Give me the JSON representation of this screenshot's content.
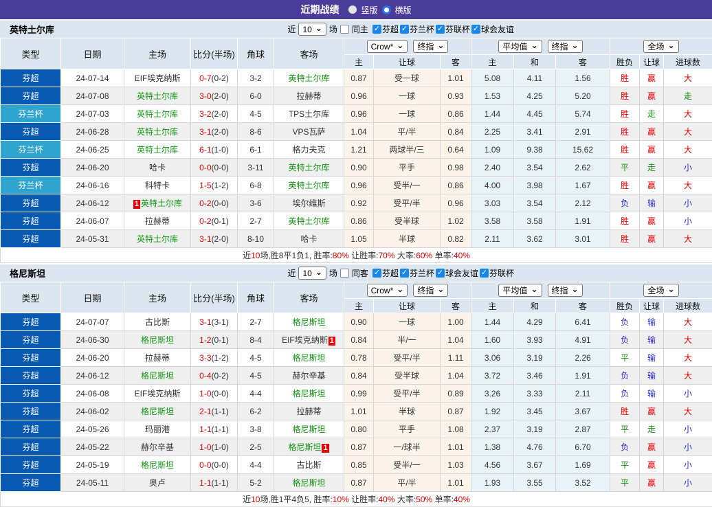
{
  "topbar": {
    "title": "近期战绩",
    "vertical_label": "竖版",
    "horizontal_label": "横版"
  },
  "icons": {
    "checkbox_check": "✓",
    "chevron_down": "⌄",
    "red_flag": "1"
  },
  "colors": {
    "accent_purple": "#4a3d99",
    "league_super": "#0759b2",
    "league_cup": "#2ea4cf",
    "team_green": "#139813",
    "score_red": "#e60000",
    "result_red": "#e60000",
    "result_green": "#108a10",
    "result_blue": "#2d2dd0",
    "header_bg": "#dce6f0",
    "odds_bg": "#fcf4ea",
    "avg_bg": "#e9f4f9",
    "alt_row_bg": "#efefef",
    "checkbox_blue": "#1a86e8"
  },
  "columns": {
    "main": [
      "类型",
      "日期",
      "主场",
      "比分(半场)",
      "角球",
      "客场"
    ],
    "sub": [
      "主",
      "让球",
      "客",
      "主",
      "和",
      "客",
      "胜负",
      "让球",
      "进球数"
    ]
  },
  "dropdowns": {
    "book": "Crow*",
    "final1": "终指",
    "avg": "平均值",
    "final2": "终指",
    "scope": "全场"
  },
  "sections": [
    {
      "team": "英特土尔库",
      "filters": {
        "near": "近",
        "count": "10",
        "games": "场",
        "same": "同主",
        "leagues": [
          "芬超",
          "芬兰杯",
          "芬联杯",
          "球会友谊"
        ]
      },
      "rows": [
        {
          "lg": "芬超",
          "cup": false,
          "date": "24-07-14",
          "home": {
            "n": "EIF埃克纳斯",
            "g": false
          },
          "score": "0-7",
          "half": "(0-2)",
          "corner": "3-2",
          "away": {
            "n": "英特土尔库",
            "g": true
          },
          "odds": [
            "0.87",
            "受一球",
            "1.01"
          ],
          "avg": [
            "5.08",
            "4.11",
            "1.56"
          ],
          "res": [
            [
              "胜",
              "r"
            ],
            [
              "赢",
              "r"
            ],
            [
              "大",
              "r"
            ]
          ]
        },
        {
          "lg": "芬超",
          "cup": false,
          "date": "24-07-08",
          "home": {
            "n": "英特土尔库",
            "g": true
          },
          "score": "3-0",
          "half": "(2-0)",
          "corner": "6-0",
          "away": {
            "n": "拉赫蒂",
            "g": false
          },
          "odds": [
            "0.96",
            "一球",
            "0.93"
          ],
          "avg": [
            "1.53",
            "4.25",
            "5.20"
          ],
          "res": [
            [
              "胜",
              "r"
            ],
            [
              "赢",
              "r"
            ],
            [
              "走",
              "g"
            ]
          ]
        },
        {
          "lg": "芬兰杯",
          "cup": true,
          "date": "24-07-03",
          "home": {
            "n": "英特土尔库",
            "g": true
          },
          "score": "3-2",
          "half": "(2-0)",
          "corner": "4-5",
          "away": {
            "n": "TPS土尔库",
            "g": false
          },
          "odds": [
            "0.96",
            "一球",
            "0.86"
          ],
          "avg": [
            "1.44",
            "4.45",
            "5.74"
          ],
          "res": [
            [
              "胜",
              "r"
            ],
            [
              "走",
              "g"
            ],
            [
              "大",
              "r"
            ]
          ]
        },
        {
          "lg": "芬超",
          "cup": false,
          "date": "24-06-28",
          "home": {
            "n": "英特土尔库",
            "g": true
          },
          "score": "3-1",
          "half": "(2-0)",
          "corner": "8-6",
          "away": {
            "n": "VPS瓦萨",
            "g": false
          },
          "odds": [
            "1.04",
            "平/半",
            "0.84"
          ],
          "avg": [
            "2.25",
            "3.41",
            "2.91"
          ],
          "res": [
            [
              "胜",
              "r"
            ],
            [
              "赢",
              "r"
            ],
            [
              "大",
              "r"
            ]
          ]
        },
        {
          "lg": "芬兰杯",
          "cup": true,
          "date": "24-06-25",
          "home": {
            "n": "英特土尔库",
            "g": true
          },
          "score": "6-1",
          "half": "(1-0)",
          "corner": "6-1",
          "away": {
            "n": "格力夫克",
            "g": false
          },
          "odds": [
            "1.21",
            "两球半/三",
            "0.64"
          ],
          "avg": [
            "1.09",
            "9.38",
            "15.62"
          ],
          "res": [
            [
              "胜",
              "r"
            ],
            [
              "赢",
              "r"
            ],
            [
              "大",
              "r"
            ]
          ]
        },
        {
          "lg": "芬超",
          "cup": false,
          "date": "24-06-20",
          "home": {
            "n": "哈卡",
            "g": false
          },
          "score": "0-0",
          "half": "(0-0)",
          "corner": "3-11",
          "away": {
            "n": "英特土尔库",
            "g": true
          },
          "odds": [
            "0.90",
            "平手",
            "0.98"
          ],
          "avg": [
            "2.40",
            "3.54",
            "2.62"
          ],
          "res": [
            [
              "平",
              "g"
            ],
            [
              "走",
              "g"
            ],
            [
              "小",
              "b"
            ]
          ]
        },
        {
          "lg": "芬兰杯",
          "cup": true,
          "date": "24-06-16",
          "home": {
            "n": "科特卡",
            "g": false
          },
          "score": "1-5",
          "half": "(1-2)",
          "corner": "6-8",
          "away": {
            "n": "英特土尔库",
            "g": true
          },
          "odds": [
            "0.96",
            "受半/一",
            "0.86"
          ],
          "avg": [
            "4.00",
            "3.98",
            "1.67"
          ],
          "res": [
            [
              "胜",
              "r"
            ],
            [
              "赢",
              "r"
            ],
            [
              "大",
              "r"
            ]
          ]
        },
        {
          "lg": "芬超",
          "cup": false,
          "date": "24-06-12",
          "home": {
            "n": "英特土尔库",
            "g": true,
            "b": "pre"
          },
          "score": "0-2",
          "half": "(0-0)",
          "corner": "3-6",
          "away": {
            "n": "埃尔维斯",
            "g": false
          },
          "odds": [
            "0.92",
            "受平/半",
            "0.96"
          ],
          "avg": [
            "3.03",
            "3.54",
            "2.12"
          ],
          "res": [
            [
              "负",
              "b"
            ],
            [
              "输",
              "b"
            ],
            [
              "小",
              "b"
            ]
          ]
        },
        {
          "lg": "芬超",
          "cup": false,
          "date": "24-06-07",
          "home": {
            "n": "拉赫蒂",
            "g": false
          },
          "score": "0-2",
          "half": "(0-1)",
          "corner": "2-7",
          "away": {
            "n": "英特土尔库",
            "g": true
          },
          "odds": [
            "0.86",
            "受半球",
            "1.02"
          ],
          "avg": [
            "3.58",
            "3.58",
            "1.91"
          ],
          "res": [
            [
              "胜",
              "r"
            ],
            [
              "赢",
              "r"
            ],
            [
              "小",
              "b"
            ]
          ]
        },
        {
          "lg": "芬超",
          "cup": false,
          "date": "24-05-31",
          "home": {
            "n": "英特土尔库",
            "g": true
          },
          "score": "3-1",
          "half": "(2-0)",
          "corner": "8-10",
          "away": {
            "n": "哈卡",
            "g": false
          },
          "odds": [
            "1.05",
            "半球",
            "0.82"
          ],
          "avg": [
            "2.11",
            "3.62",
            "3.01"
          ],
          "res": [
            [
              "胜",
              "r"
            ],
            [
              "赢",
              "r"
            ],
            [
              "大",
              "r"
            ]
          ]
        }
      ],
      "summary": [
        {
          "t": "近"
        },
        {
          "t": "10",
          "red": true
        },
        {
          "t": "场,胜8平1负1, 胜率:"
        },
        {
          "t": "80%",
          "red": true
        },
        {
          "t": " 让胜率:"
        },
        {
          "t": "70%",
          "red": true
        },
        {
          "t": " 大率:"
        },
        {
          "t": "60%",
          "red": true
        },
        {
          "t": " 单率:"
        },
        {
          "t": "40%",
          "red": true
        }
      ]
    },
    {
      "team": "格尼斯坦",
      "filters": {
        "near": "近",
        "count": "10",
        "games": "场",
        "same": "同客",
        "leagues": [
          "芬超",
          "芬兰杯",
          "球会友谊",
          "芬联杯"
        ]
      },
      "rows": [
        {
          "lg": "芬超",
          "cup": false,
          "date": "24-07-07",
          "home": {
            "n": "古比斯",
            "g": false
          },
          "score": "3-1",
          "half": "(3-1)",
          "corner": "2-7",
          "away": {
            "n": "格尼斯坦",
            "g": true
          },
          "odds": [
            "0.90",
            "一球",
            "1.00"
          ],
          "avg": [
            "1.44",
            "4.29",
            "6.41"
          ],
          "res": [
            [
              "负",
              "b"
            ],
            [
              "输",
              "b"
            ],
            [
              "大",
              "r"
            ]
          ]
        },
        {
          "lg": "芬超",
          "cup": false,
          "date": "24-06-30",
          "home": {
            "n": "格尼斯坦",
            "g": true
          },
          "score": "1-2",
          "half": "(0-1)",
          "corner": "8-4",
          "away": {
            "n": "EIF埃克纳斯",
            "g": false,
            "b": "post"
          },
          "odds": [
            "0.84",
            "半/一",
            "1.04"
          ],
          "avg": [
            "1.60",
            "3.93",
            "4.91"
          ],
          "res": [
            [
              "负",
              "b"
            ],
            [
              "输",
              "b"
            ],
            [
              "大",
              "r"
            ]
          ]
        },
        {
          "lg": "芬超",
          "cup": false,
          "date": "24-06-20",
          "home": {
            "n": "拉赫蒂",
            "g": false
          },
          "score": "3-3",
          "half": "(1-2)",
          "corner": "4-5",
          "away": {
            "n": "格尼斯坦",
            "g": true
          },
          "odds": [
            "0.78",
            "受平/半",
            "1.11"
          ],
          "avg": [
            "3.06",
            "3.19",
            "2.26"
          ],
          "res": [
            [
              "平",
              "g"
            ],
            [
              "输",
              "b"
            ],
            [
              "大",
              "r"
            ]
          ]
        },
        {
          "lg": "芬超",
          "cup": false,
          "date": "24-06-12",
          "home": {
            "n": "格尼斯坦",
            "g": true
          },
          "score": "0-4",
          "half": "(0-2)",
          "corner": "4-5",
          "away": {
            "n": "赫尔辛基",
            "g": false
          },
          "odds": [
            "0.84",
            "受半球",
            "1.04"
          ],
          "avg": [
            "3.72",
            "3.46",
            "1.91"
          ],
          "res": [
            [
              "负",
              "b"
            ],
            [
              "输",
              "b"
            ],
            [
              "大",
              "r"
            ]
          ]
        },
        {
          "lg": "芬超",
          "cup": false,
          "date": "24-06-08",
          "home": {
            "n": "EIF埃克纳斯",
            "g": false
          },
          "score": "1-0",
          "half": "(0-0)",
          "corner": "4-4",
          "away": {
            "n": "格尼斯坦",
            "g": true
          },
          "odds": [
            "0.99",
            "受平/半",
            "0.89"
          ],
          "avg": [
            "3.26",
            "3.33",
            "2.11"
          ],
          "res": [
            [
              "负",
              "b"
            ],
            [
              "输",
              "b"
            ],
            [
              "小",
              "b"
            ]
          ]
        },
        {
          "lg": "芬超",
          "cup": false,
          "date": "24-06-02",
          "home": {
            "n": "格尼斯坦",
            "g": true
          },
          "score": "2-1",
          "half": "(1-1)",
          "corner": "6-2",
          "away": {
            "n": "拉赫蒂",
            "g": false
          },
          "odds": [
            "1.01",
            "半球",
            "0.87"
          ],
          "avg": [
            "1.92",
            "3.45",
            "3.67"
          ],
          "res": [
            [
              "胜",
              "r"
            ],
            [
              "赢",
              "r"
            ],
            [
              "大",
              "r"
            ]
          ]
        },
        {
          "lg": "芬超",
          "cup": false,
          "date": "24-05-26",
          "home": {
            "n": "玛丽港",
            "g": false
          },
          "score": "1-1",
          "half": "(1-1)",
          "corner": "3-8",
          "away": {
            "n": "格尼斯坦",
            "g": true
          },
          "odds": [
            "0.80",
            "平手",
            "1.08"
          ],
          "avg": [
            "2.37",
            "3.19",
            "2.87"
          ],
          "res": [
            [
              "平",
              "g"
            ],
            [
              "走",
              "g"
            ],
            [
              "小",
              "b"
            ]
          ]
        },
        {
          "lg": "芬超",
          "cup": false,
          "date": "24-05-22",
          "home": {
            "n": "赫尔辛基",
            "g": false
          },
          "score": "1-0",
          "half": "(1-0)",
          "corner": "2-5",
          "away": {
            "n": "格尼斯坦",
            "g": true,
            "b": "post"
          },
          "odds": [
            "0.87",
            "一/球半",
            "1.01"
          ],
          "avg": [
            "1.38",
            "4.76",
            "6.70"
          ],
          "res": [
            [
              "负",
              "b"
            ],
            [
              "赢",
              "r"
            ],
            [
              "小",
              "b"
            ]
          ]
        },
        {
          "lg": "芬超",
          "cup": false,
          "date": "24-05-19",
          "home": {
            "n": "格尼斯坦",
            "g": true
          },
          "score": "0-0",
          "half": "(0-0)",
          "corner": "4-4",
          "away": {
            "n": "古比斯",
            "g": false
          },
          "odds": [
            "0.85",
            "受半/一",
            "1.03"
          ],
          "avg": [
            "4.56",
            "3.67",
            "1.69"
          ],
          "res": [
            [
              "平",
              "g"
            ],
            [
              "赢",
              "r"
            ],
            [
              "小",
              "b"
            ]
          ]
        },
        {
          "lg": "芬超",
          "cup": false,
          "date": "24-05-11",
          "home": {
            "n": "奥卢",
            "g": false
          },
          "score": "1-1",
          "half": "(1-1)",
          "corner": "5-2",
          "away": {
            "n": "格尼斯坦",
            "g": true
          },
          "odds": [
            "0.87",
            "平/半",
            "1.01"
          ],
          "avg": [
            "1.93",
            "3.55",
            "3.52"
          ],
          "res": [
            [
              "平",
              "g"
            ],
            [
              "赢",
              "r"
            ],
            [
              "小",
              "b"
            ]
          ]
        }
      ],
      "summary": [
        {
          "t": "近"
        },
        {
          "t": "10",
          "red": true
        },
        {
          "t": "场,胜1平4负5, 胜率:"
        },
        {
          "t": "10%",
          "red": true
        },
        {
          "t": " 让胜率:"
        },
        {
          "t": "40%",
          "red": true
        },
        {
          "t": " 大率:"
        },
        {
          "t": "50%",
          "red": true
        },
        {
          "t": " 单率:"
        },
        {
          "t": "40%",
          "red": true
        }
      ]
    }
  ]
}
